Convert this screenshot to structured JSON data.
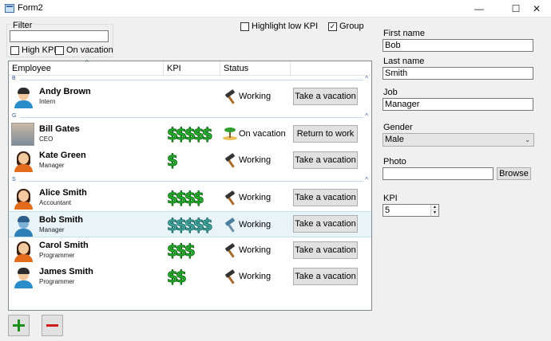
{
  "window": {
    "title": "Form2",
    "minimize": "—",
    "maximize": "☐",
    "close": "✕"
  },
  "filter": {
    "label": "Filter",
    "value": "",
    "high_kpi": "High KPI",
    "on_vacation": "On vacation"
  },
  "options": {
    "highlight_low_kpi": "Highlight low KPI",
    "group": "Group",
    "group_checked": "✓"
  },
  "list": {
    "columns": [
      "Employee",
      "KPI",
      "Status"
    ],
    "sort_indicator": "^",
    "groups": [
      {
        "letter": "B",
        "caret": "^"
      },
      {
        "letter": "G",
        "caret": "^"
      },
      {
        "letter": "S",
        "caret": "^"
      }
    ],
    "rows": [
      {
        "name": "Andy Brown",
        "role": "Intern",
        "kpi": "",
        "status": "Working",
        "action": "Take a vacation"
      },
      {
        "name": "Bill Gates",
        "role": "CEO",
        "kpi": "$$$$$",
        "status": "On vacation",
        "action": "Return to work"
      },
      {
        "name": "Kate Green",
        "role": "Manager",
        "kpi": "$",
        "status": "Working",
        "action": "Take a vacation"
      },
      {
        "name": "Alice Smith",
        "role": "Accountant",
        "kpi": "$$$$",
        "status": "Working",
        "action": "Take a vacation"
      },
      {
        "name": "Bob Smith",
        "role": "Manager",
        "kpi": "$$$$$",
        "status": "Working",
        "action": "Take a vacation"
      },
      {
        "name": "Carol Smith",
        "role": "Programmer",
        "kpi": "$$$",
        "status": "Working",
        "action": "Take a vacation"
      },
      {
        "name": "James Smith",
        "role": "Programmer",
        "kpi": "$$",
        "status": "Working",
        "action": "Take a vacation"
      }
    ]
  },
  "details": {
    "first_name_label": "First name",
    "first_name": "Bob",
    "last_name_label": "Last name",
    "last_name": "Smith",
    "job_label": "Job",
    "job": "Manager",
    "gender_label": "Gender",
    "gender": "Male",
    "gender_arrow": "⌄",
    "photo_label": "Photo",
    "photo": "",
    "browse": "Browse",
    "kpi_label": "KPI",
    "kpi": "5",
    "spin_up": "▲",
    "spin_down": "▼"
  },
  "colors": {
    "kpi_green": "#24b22a",
    "selected_row": "#e8f4f8",
    "add": "#1a8f1a",
    "remove": "#d01a1a"
  }
}
